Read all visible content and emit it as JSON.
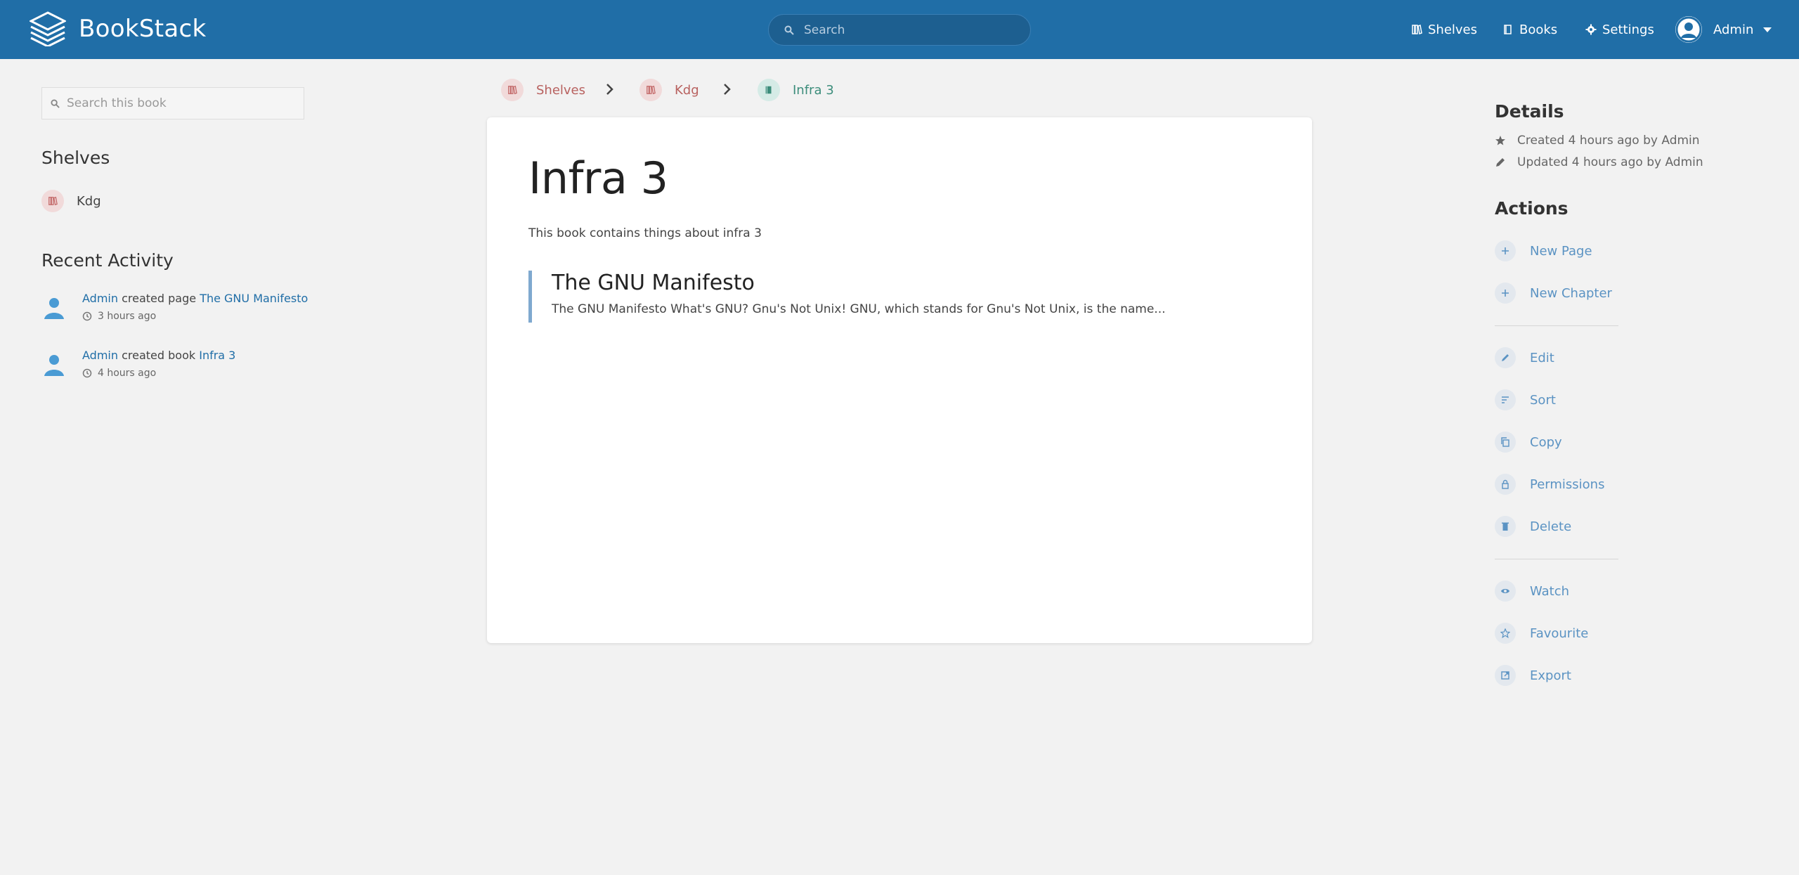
{
  "header": {
    "app_name": "BookStack",
    "search_placeholder": "Search",
    "nav": {
      "shelves": "Shelves",
      "books": "Books",
      "settings": "Settings"
    },
    "user_name": "Admin",
    "bg_color": "#206ea7"
  },
  "left": {
    "search_placeholder": "Search this book",
    "shelves_heading": "Shelves",
    "shelves": [
      {
        "label": "Kdg"
      }
    ],
    "activity_heading": "Recent Activity",
    "activity": [
      {
        "user": "Admin",
        "action": "created page",
        "target": "The GNU Manifesto",
        "time": "3 hours ago"
      },
      {
        "user": "Admin",
        "action": "created book",
        "target": "Infra 3",
        "time": "4 hours ago"
      }
    ]
  },
  "breadcrumb": [
    {
      "label": "Shelves",
      "color": "#b8615f"
    },
    {
      "label": "Kdg",
      "color": "#b8615f"
    },
    {
      "label": "Infra 3",
      "color": "#3c8d7b"
    }
  ],
  "book": {
    "title": "Infra 3",
    "description": "This book contains things about infra 3",
    "pages": [
      {
        "title": "The GNU Manifesto",
        "excerpt": "The GNU Manifesto What's GNU? Gnu's Not Unix! GNU, which stands for Gnu's Not Unix, is the name..."
      }
    ]
  },
  "right": {
    "details_heading": "Details",
    "created": "Created 4 hours ago by Admin",
    "updated": "Updated 4 hours ago by Admin",
    "actions_heading": "Actions",
    "actions": {
      "new_page": "New Page",
      "new_chapter": "New Chapter",
      "edit": "Edit",
      "sort": "Sort",
      "copy": "Copy",
      "permissions": "Permissions",
      "delete": "Delete",
      "watch": "Watch",
      "favourite": "Favourite",
      "export": "Export"
    }
  }
}
